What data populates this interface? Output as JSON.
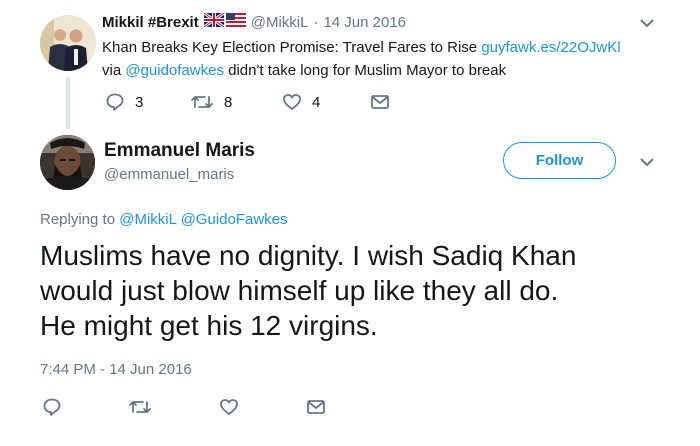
{
  "parent_tweet": {
    "display_name": "Mikkil #Brexit",
    "handle": "@MikkiL",
    "separator": "·",
    "date": "14 Jun 2016",
    "text_line1_prefix": "Khan Breaks Key Election Promise: Travel Fares to Rise ",
    "text_line1_link": "guyfawk.es/22OJwKl",
    "text_line2_prefix": "via ",
    "text_line2_mention": "@guidofawkes",
    "text_line2_rest": " didn't take long for Muslim Mayor to break",
    "reply_count": "3",
    "retweet_count": "8",
    "like_count": "4"
  },
  "main_tweet": {
    "display_name": "Emmanuel Maris",
    "handle": "@emmanuel_maris",
    "follow_label": "Follow",
    "replying_to_label": "Replying to ",
    "replying_to_mention1": "@MikkiL",
    "replying_to_mention2": "@GuidoFawkes",
    "text_line1": "Muslims have no dignity. I wish Sadiq Khan",
    "text_line2": "would just blow himself up like they all do.",
    "text_line3": "He might get his 12 virgins.",
    "timestamp": "7:44 PM - 14 Jun 2016"
  },
  "colors": {
    "accent": "#1b95e0",
    "muted": "#657786",
    "thread_line": "#e1e8ed"
  },
  "icons": [
    "chevron-down-icon",
    "reply-icon",
    "retweet-icon",
    "like-icon",
    "message-icon",
    "uk-flag-icon",
    "us-flag-icon"
  ]
}
